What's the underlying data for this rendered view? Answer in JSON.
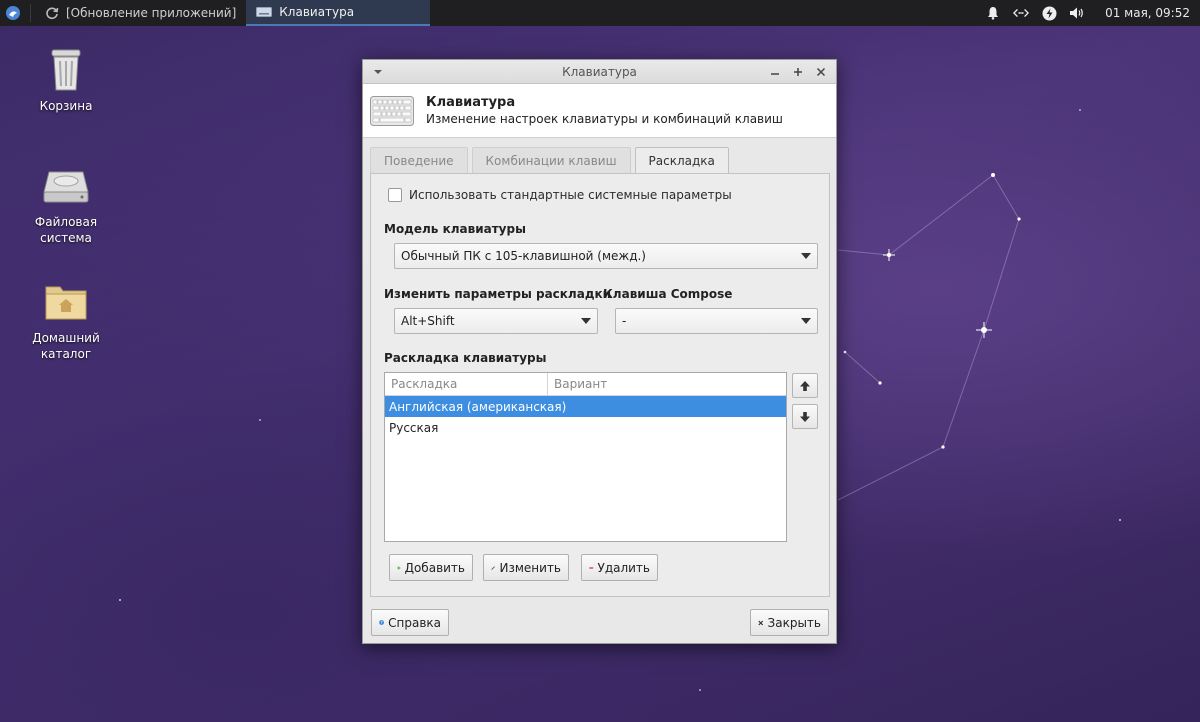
{
  "taskbar": {
    "tasks": [
      {
        "label": "[Обновление приложений]"
      },
      {
        "label": "Клавиатура"
      }
    ],
    "datetime": "01 мая, 09:52"
  },
  "desktop": {
    "icons": [
      {
        "label": "Корзина"
      },
      {
        "label": "Файловая система"
      },
      {
        "label": "Домашний каталог"
      }
    ]
  },
  "dialog": {
    "window_title": "Клавиатура",
    "header_title": "Клавиатура",
    "header_subtitle": "Изменение настроек клавиатуры и комбинаций клавиш",
    "tabs": [
      {
        "label": "Поведение",
        "active": false
      },
      {
        "label": "Комбинации клавиш",
        "active": false
      },
      {
        "label": "Раскладка",
        "active": true
      }
    ],
    "use_system_defaults": {
      "label": "Использовать стандартные системные параметры",
      "checked": false
    },
    "model": {
      "label": "Модель клавиатуры",
      "value": "Обычный ПК с 105-клавишной (межд.)"
    },
    "switch": {
      "label": "Изменить параметры раскладки",
      "value": "Alt+Shift"
    },
    "compose": {
      "label": "Клавиша Compose",
      "value": "-"
    },
    "layouts": {
      "label": "Раскладка клавиатуры",
      "columns": [
        "Раскладка",
        "Вариант"
      ],
      "rows": [
        {
          "layout": "Английская (американская)",
          "variant": "",
          "selected": true
        },
        {
          "layout": "Русская",
          "variant": "",
          "selected": false
        }
      ]
    },
    "buttons": {
      "add": "Добавить",
      "edit": "Изменить",
      "remove": "Удалить",
      "help": "Справка",
      "close": "Закрыть"
    }
  }
}
